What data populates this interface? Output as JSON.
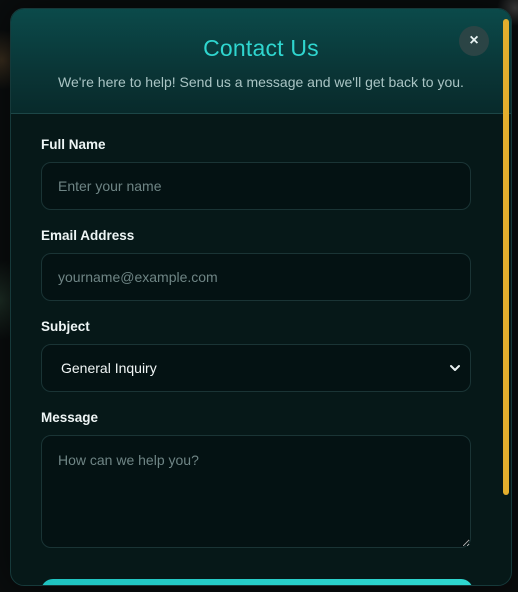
{
  "dialog": {
    "title": "Contact Us",
    "subtitle": "We're here to help! Send us a message and we'll get back to you.",
    "close_label": "×"
  },
  "form": {
    "full_name": {
      "label": "Full Name",
      "value": "",
      "placeholder": "Enter your name"
    },
    "email": {
      "label": "Email Address",
      "value": "",
      "placeholder": "yourname@example.com"
    },
    "subject": {
      "label": "Subject",
      "selected": "General Inquiry"
    },
    "message": {
      "label": "Message",
      "value": "",
      "placeholder": "How can we help you?"
    }
  },
  "icons": {
    "close": "close-icon",
    "select_caret": "chevron-down-icon",
    "textarea_resize": "resize-grip-icon"
  },
  "colors": {
    "accent": "#2fd6cf",
    "header_bg": "#0b4a4a",
    "panel_bg": "#061818",
    "field_bg": "#041213",
    "scrollbar": "#e3ae2d"
  }
}
